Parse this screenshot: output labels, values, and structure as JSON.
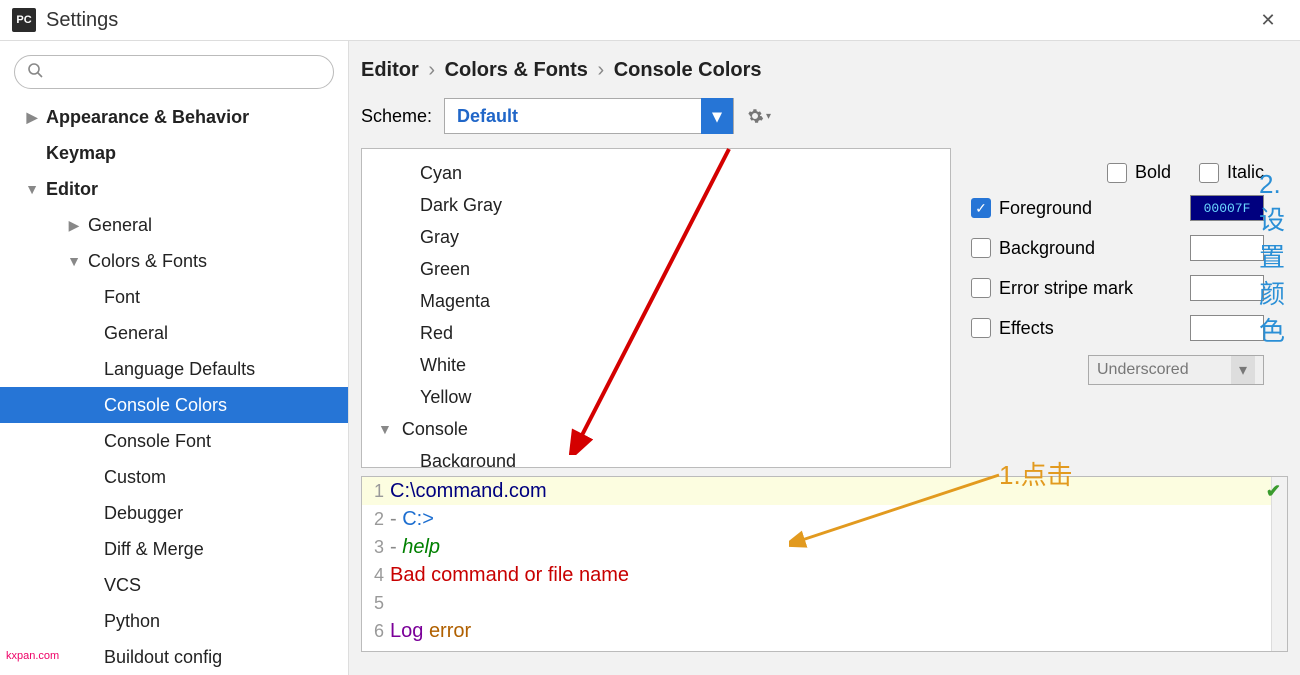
{
  "window": {
    "title": "Settings",
    "app_badge": "PC"
  },
  "search": {
    "placeholder": ""
  },
  "sidebar": {
    "items": [
      {
        "label": "Appearance & Behavior",
        "chev": "▶",
        "cls": "top"
      },
      {
        "label": "Keymap",
        "chev": "",
        "cls": "top"
      },
      {
        "label": "Editor",
        "chev": "▼",
        "cls": "top"
      },
      {
        "label": "General",
        "chev": "▶",
        "cls": "sub"
      },
      {
        "label": "Colors & Fonts",
        "chev": "▼",
        "cls": "sub"
      },
      {
        "label": "Font",
        "chev": "",
        "cls": "subsub"
      },
      {
        "label": "General",
        "chev": "",
        "cls": "subsub"
      },
      {
        "label": "Language Defaults",
        "chev": "",
        "cls": "subsub"
      },
      {
        "label": "Console Colors",
        "chev": "",
        "cls": "subsub",
        "selected": true
      },
      {
        "label": "Console Font",
        "chev": "",
        "cls": "subsub"
      },
      {
        "label": "Custom",
        "chev": "",
        "cls": "subsub"
      },
      {
        "label": "Debugger",
        "chev": "",
        "cls": "subsub"
      },
      {
        "label": "Diff & Merge",
        "chev": "",
        "cls": "subsub"
      },
      {
        "label": "VCS",
        "chev": "",
        "cls": "subsub"
      },
      {
        "label": "Python",
        "chev": "",
        "cls": "subsub"
      },
      {
        "label": "Buildout config",
        "chev": "",
        "cls": "subsub"
      }
    ]
  },
  "breadcrumb": {
    "p1": "Editor",
    "p2": "Colors & Fonts",
    "p3": "Console Colors",
    "sep": "›"
  },
  "scheme": {
    "label": "Scheme:",
    "value": "Default"
  },
  "color_list": {
    "items": [
      "Cyan",
      "Dark Gray",
      "Gray",
      "Green",
      "Magenta",
      "Red",
      "White",
      "Yellow"
    ],
    "group": {
      "label": "Console",
      "child": "Background"
    }
  },
  "props": {
    "bold": "Bold",
    "italic": "Italic",
    "foreground": "Foreground",
    "fg_hex": "00007F",
    "background": "Background",
    "errstripe": "Error stripe mark",
    "effects": "Effects",
    "effects_value": "Underscored"
  },
  "preview": {
    "lines": [
      {
        "n": "1",
        "hl": true,
        "segs": [
          {
            "t": "C:\\command.com",
            "c": "c-navy"
          }
        ]
      },
      {
        "n": "2",
        "segs": [
          {
            "t": "-",
            "c": "c-gray"
          },
          {
            "t": " "
          },
          {
            "t": "C:>",
            "c": "c-blue"
          }
        ]
      },
      {
        "n": "3",
        "segs": [
          {
            "t": "-",
            "c": "c-gray"
          },
          {
            "t": " "
          },
          {
            "t": "help",
            "c": "c-green"
          }
        ]
      },
      {
        "n": "4",
        "segs": [
          {
            "t": "Bad command or file name",
            "c": "c-red"
          }
        ]
      },
      {
        "n": "5",
        "segs": []
      },
      {
        "n": "6",
        "segs": [
          {
            "t": "Log ",
            "c": "c-purple"
          },
          {
            "t": "error",
            "c": "c-orange"
          }
        ]
      }
    ]
  },
  "annotations": {
    "a1": "1.点击",
    "a2": "2. 设置颜色"
  },
  "watermark": "kxpan.com"
}
